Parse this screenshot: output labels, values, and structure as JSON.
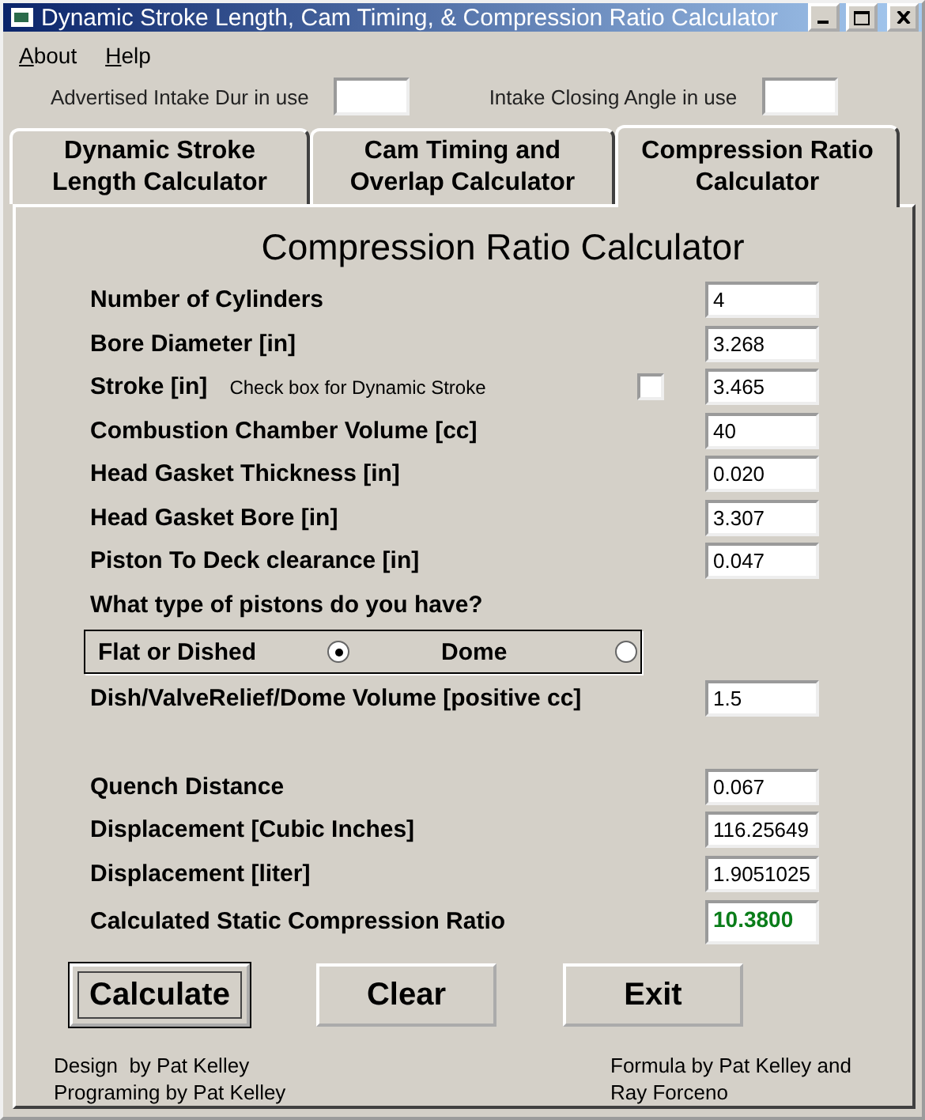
{
  "window": {
    "title": "Dynamic Stroke Length, Cam Timing, & Compression Ratio Calculator"
  },
  "menu": [
    {
      "label": "About"
    },
    {
      "label": "Help"
    }
  ],
  "top_fields": [
    {
      "label": "Advertised Intake Dur in use"
    },
    {
      "label": "Intake Closing Angle in use"
    }
  ],
  "tabs": [
    {
      "label": "Dynamic Stroke Length Calculator",
      "selected": false
    },
    {
      "label": "Cam Timing and Overlap Calculator",
      "selected": false
    },
    {
      "label": "Compression Ratio Calculator",
      "selected": true
    }
  ],
  "panel": {
    "title": "Compression Ratio Calculator",
    "rows": [
      {
        "kind": "field",
        "label": "Number of Cylinders",
        "value": "4"
      },
      {
        "kind": "field",
        "label": "Bore Diameter [in]",
        "value": "3.268"
      },
      {
        "kind": "check_field",
        "label": "Stroke [in]",
        "note": "Check box for Dynamic Stroke",
        "checked": false,
        "value": "3.465"
      },
      {
        "kind": "field",
        "label": "Combustion Chamber Volume [cc]",
        "value": "40"
      },
      {
        "kind": "field",
        "label": "Head Gasket Thickness [in]",
        "value": "0.020"
      },
      {
        "kind": "field",
        "label": "Head Gasket Bore [in]",
        "value": "3.307"
      },
      {
        "kind": "field",
        "label": "Piston To Deck clearance [in]",
        "value": "0.047"
      },
      {
        "kind": "question",
        "label": "What type of pistons do you have?"
      },
      {
        "kind": "radio_group",
        "options": [
          {
            "label": "Flat or Dished",
            "selected": true
          },
          {
            "label": "Dome",
            "selected": false
          }
        ]
      },
      {
        "kind": "field",
        "label": "Dish/ValveRelief/Dome Volume [positive cc]",
        "value": "1.5"
      }
    ],
    "results": [
      {
        "label": "Quench Distance",
        "value": "0.067",
        "highlight": false
      },
      {
        "label": "Displacement [Cubic Inches]",
        "value": "116.25649",
        "highlight": false
      },
      {
        "label": "Displacement [liter]",
        "value": "1.9051025",
        "highlight": false
      },
      {
        "label": "Calculated Static Compression Ratio",
        "value": "10.3800",
        "highlight": true
      }
    ]
  },
  "buttons": [
    {
      "label": "Calculate",
      "default": true
    },
    {
      "label": "Clear",
      "default": false
    },
    {
      "label": "Exit",
      "default": false
    }
  ],
  "credits_left": [
    "Design  by Pat Kelley",
    "Programing by Pat Kelley"
  ],
  "credits_right": "Formula by Pat Kelley and Ray Forceno"
}
